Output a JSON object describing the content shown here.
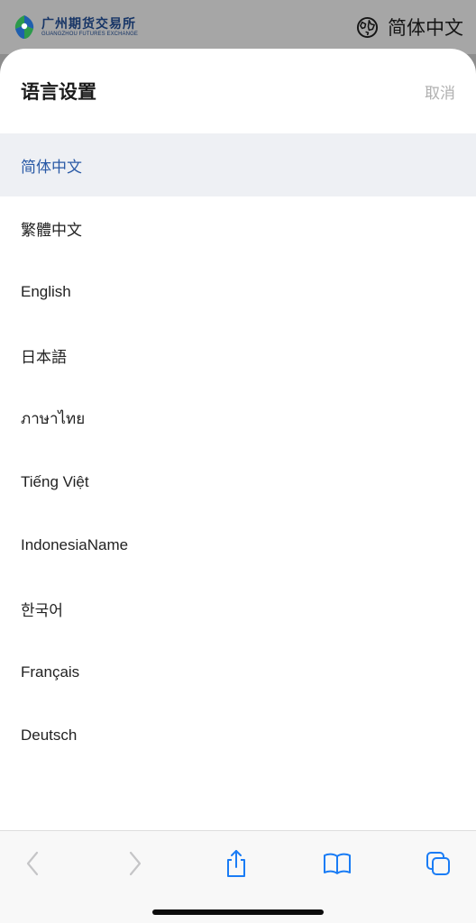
{
  "header": {
    "brand_name": "广州期货交易所",
    "brand_subtitle": "GUANGZHOU FUTURES EXCHANGE",
    "current_language": "简体中文",
    "language_icon": "globe-icon"
  },
  "sheet": {
    "title": "语言设置",
    "cancel_label": "取消",
    "selected_index": 0,
    "languages": [
      "简体中文",
      "繁體中文",
      "English",
      "日本語",
      "ภาษาไทย",
      "Tiếng Việt",
      "IndonesiaName",
      "한국어",
      "Français",
      "Deutsch"
    ]
  },
  "toolbar": {
    "buttons": [
      "back-icon",
      "forward-icon",
      "share-icon",
      "bookmarks-icon",
      "tabs-icon"
    ]
  },
  "colors": {
    "accent": "#2a5aa6",
    "brand_navy": "#173566",
    "brand_green": "#2c9a4b",
    "toolbar_active": "#1a7cf5",
    "toolbar_disabled": "#c5c5c7"
  }
}
